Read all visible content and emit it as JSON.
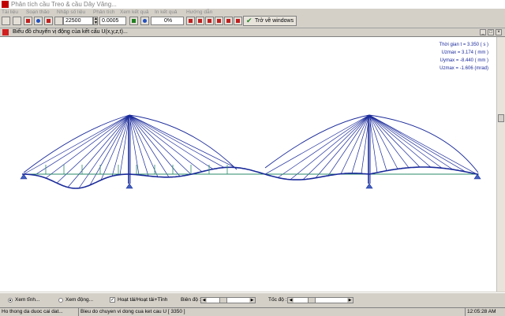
{
  "window": {
    "title": "Phân tích cầu Treo & cầu Dây Văng..."
  },
  "menu": {
    "items": [
      "Tài liệu",
      "Soạn thảo",
      "Nhập số liệu",
      "Phân tích",
      "Xem kết quả",
      "In kết quả",
      "Hướng dẫn"
    ]
  },
  "toolbar": {
    "field_a": "22500",
    "field_b": "0.0005",
    "progress": "0%",
    "back_label": "Trở về windows"
  },
  "child_window": {
    "title": "Biểu đồ chuyển vị động của kết cấu U(x,y,z,t)..."
  },
  "readouts": {
    "time": "Thời gian t = 3.350 ( s )",
    "umax": "Uzmax = 3.174 ( mm )",
    "umin": "Uymax = -8.440 ( mm )",
    "urot": "Uzmax = -1.606 (mrad)"
  },
  "controls": {
    "radio_static": "Xem tĩnh...",
    "radio_dynamic": "Xem động...",
    "check_load": "Hoạt tải/Hoạt tải+Tĩnh",
    "amplitude_label": "Biên độ :",
    "speed_label": "Tốc độ :",
    "amplitude_level": 0.35,
    "speed_level": 0.3
  },
  "status": {
    "left": "Ho thong da duoc cai dat...",
    "center": "Bieu do chuyen vi dong cua ket cau U [ 3350 ]",
    "clock": "12:05:28 AM"
  },
  "colors": {
    "structure": "#1a2a9a",
    "deck": "#2a8a6a",
    "accent_red": "#c00000"
  }
}
